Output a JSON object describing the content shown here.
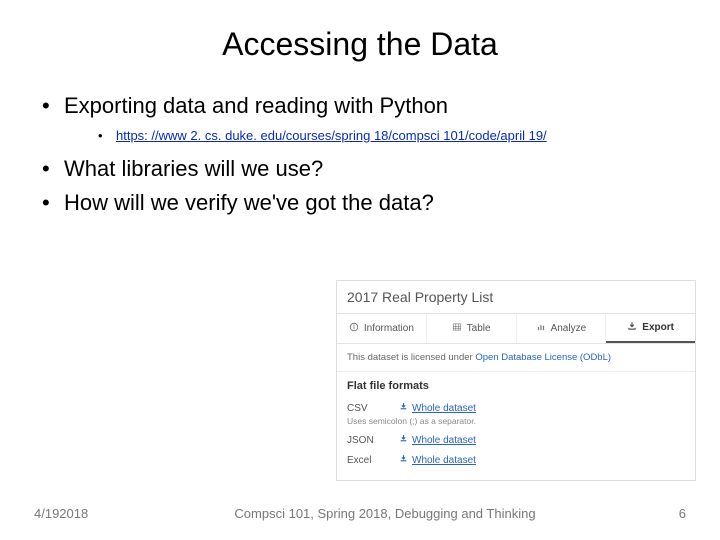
{
  "title": "Accessing the Data",
  "bullets": {
    "b1": "Exporting data and reading with Python",
    "b1_link": "https: //www 2. cs. duke. edu/courses/spring 18/compsci 101/code/april 19/",
    "b2": "What libraries will we use?",
    "b3": "How will we verify we've got the data?"
  },
  "embed": {
    "title": "2017 Real Property List",
    "tabs": {
      "info": "Information",
      "table": "Table",
      "analyze": "Analyze",
      "export": "Export"
    },
    "license_prefix": "This dataset is licensed under ",
    "license_name": "Open Database License (ODbL)",
    "flat_header": "Flat file formats",
    "formats": {
      "csv": "CSV",
      "csv_note": "Uses semicolon (;) as a separator.",
      "json": "JSON",
      "excel": "Excel",
      "whole": "Whole dataset"
    }
  },
  "footer": {
    "date": "4/192018",
    "center": "Compsci 101, Spring 2018, Debugging and Thinking",
    "page": "6"
  }
}
